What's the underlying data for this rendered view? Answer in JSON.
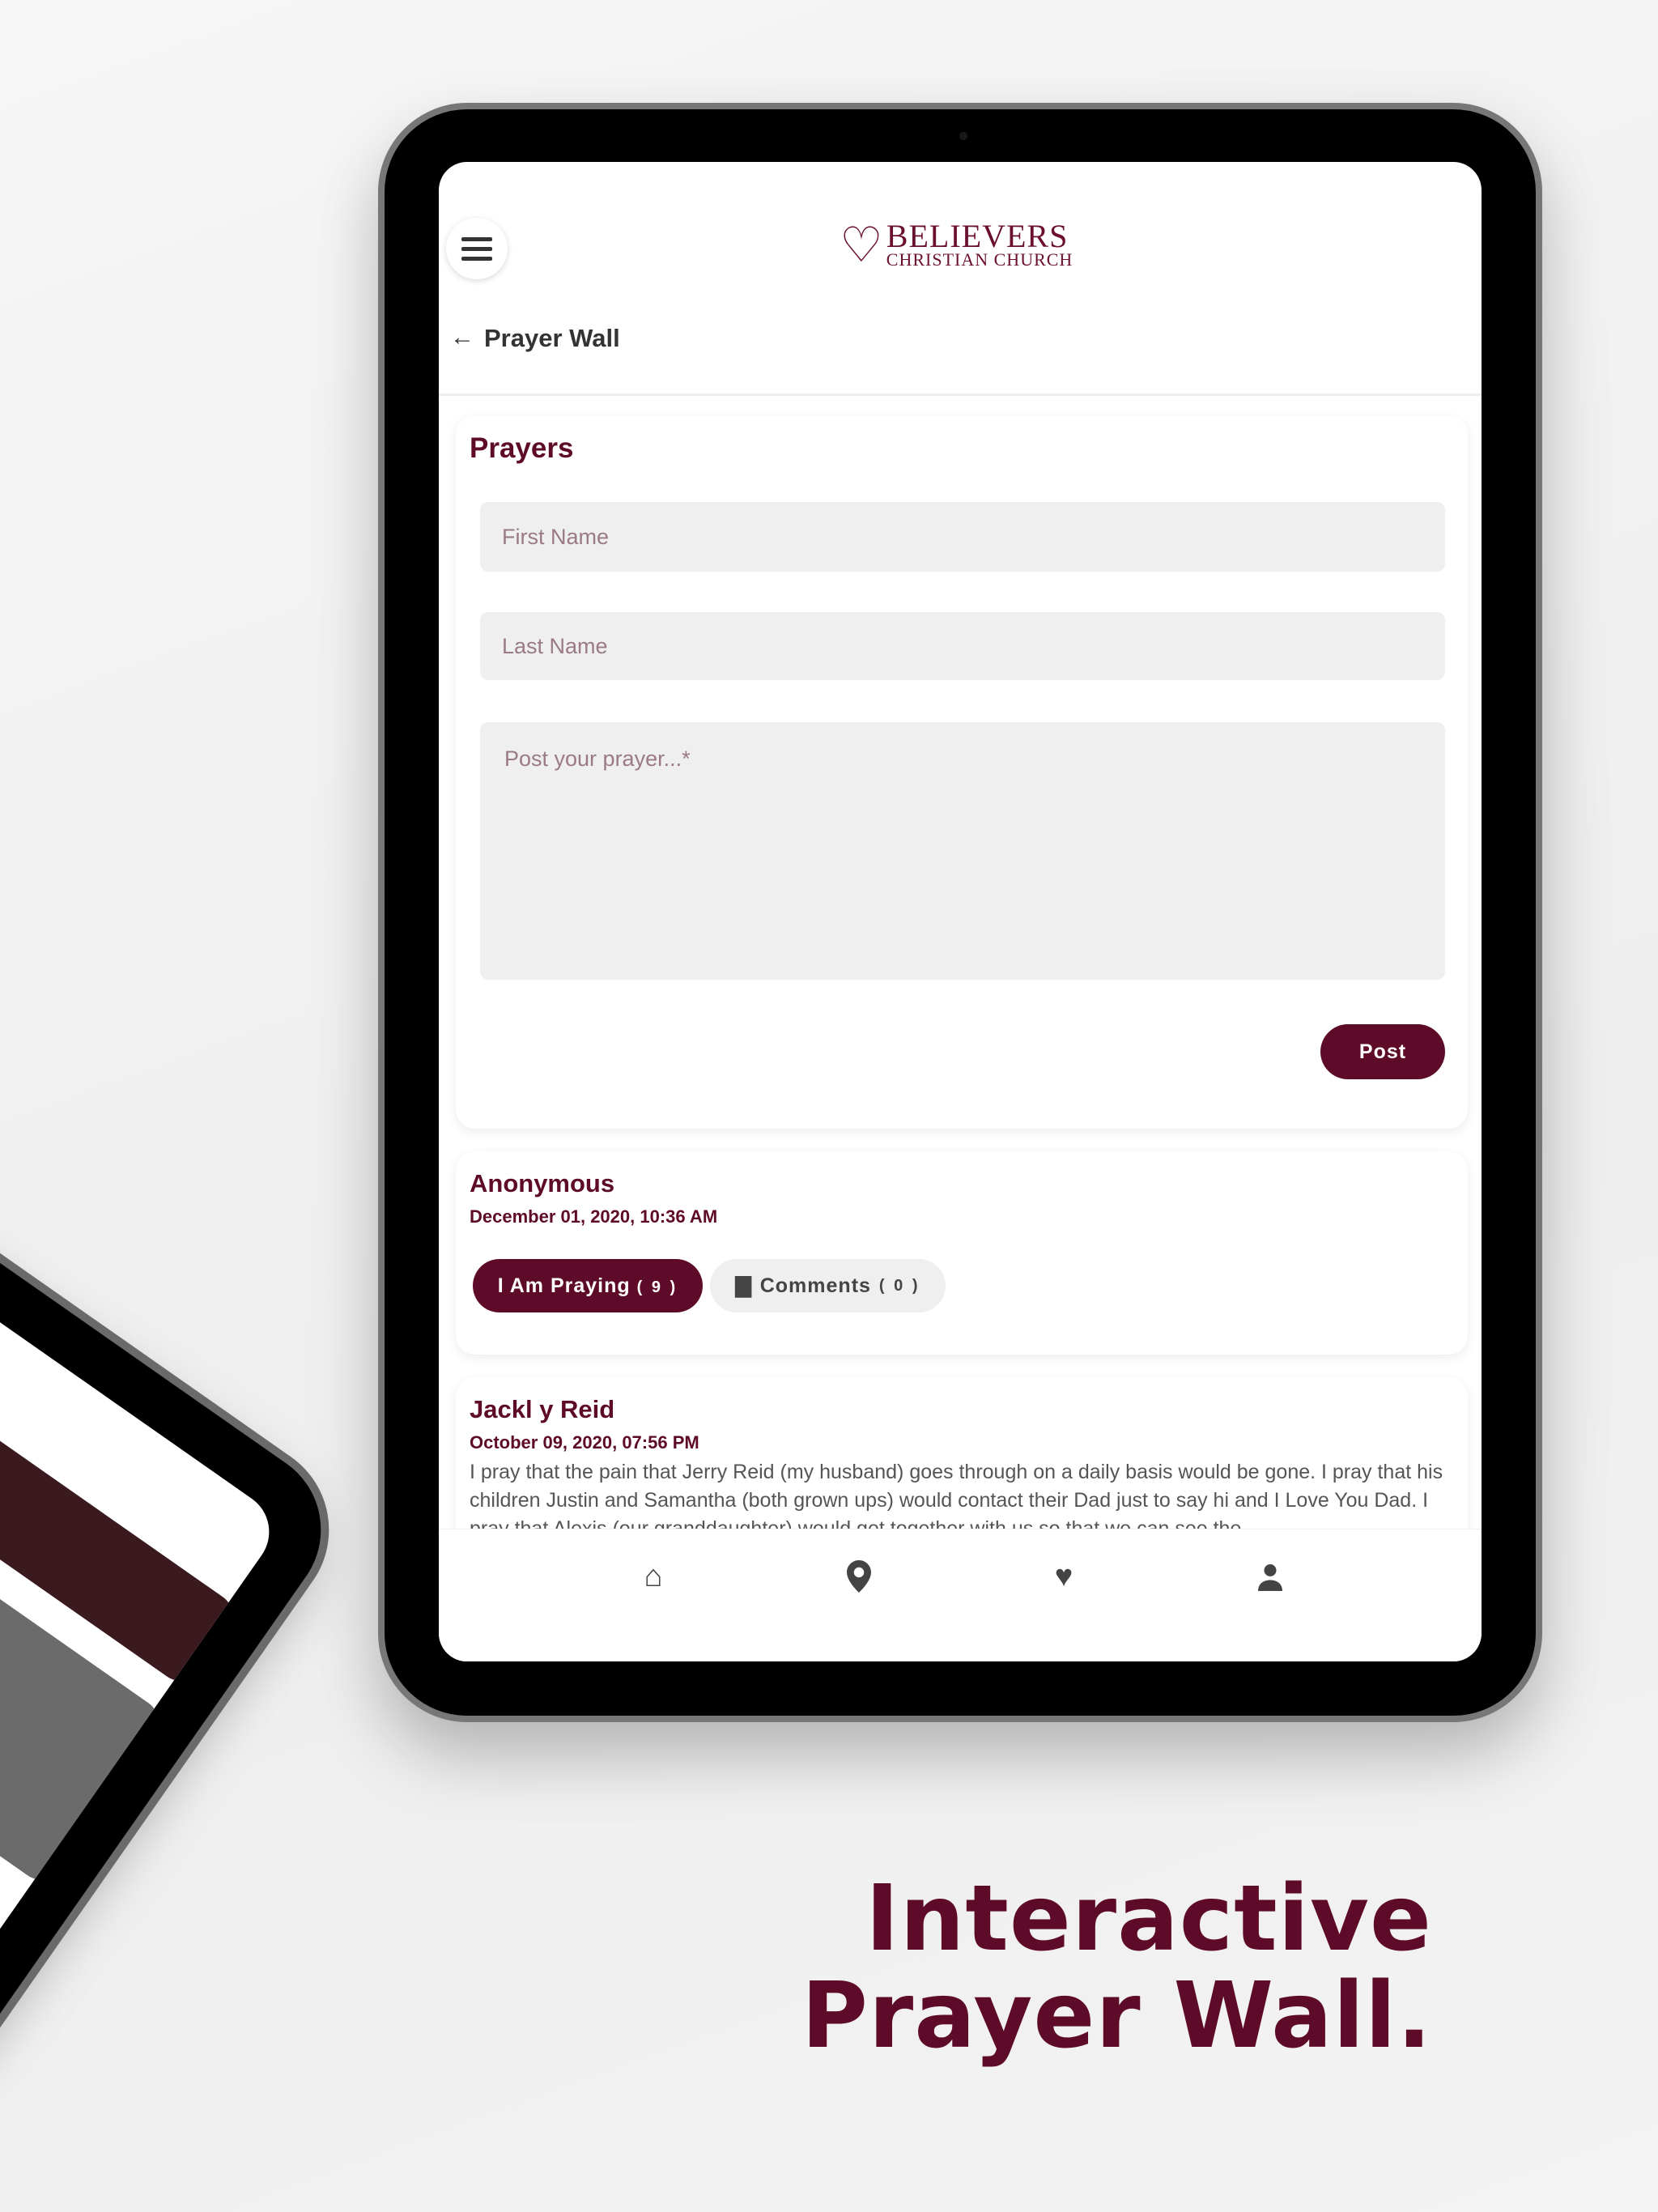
{
  "app": {
    "logo_line1": "BELIEVERS",
    "logo_line2": "CHRISTIAN CHURCH",
    "page_title": "Prayer Wall"
  },
  "form": {
    "title": "Prayers",
    "first_name_placeholder": "First Name",
    "last_name_placeholder": "Last Name",
    "prayer_placeholder": "Post your prayer...*",
    "post_label": "Post"
  },
  "posts": [
    {
      "name": "Anonymous",
      "date": "December 01, 2020, 10:36 AM",
      "praying_label": "I Am Praying",
      "praying_count": "( 9 )",
      "comments_label": "Comments",
      "comments_count": "( 0 )"
    },
    {
      "name": "Jackl y Reid",
      "date": "October 09, 2020, 07:56 PM",
      "text": "I pray that the pain that Jerry Reid (my husband) goes through on a daily basis would be gone. I pray that his children Justin and Samantha (both grown ups) would contact their Dad just to say hi and I Love You Dad. I pray that Alexis (our granddaughter) would get together with us so that we can see the"
    }
  ],
  "nav": {
    "items": [
      {
        "icon": "home-icon"
      },
      {
        "icon": "location-pin-icon"
      },
      {
        "icon": "heart-icon"
      },
      {
        "icon": "person-icon"
      }
    ]
  },
  "marketing": {
    "line1": "Interactive",
    "line2": "Prayer Wall."
  },
  "colors": {
    "brand": "#5e0b29",
    "field_bg": "#efefef"
  }
}
